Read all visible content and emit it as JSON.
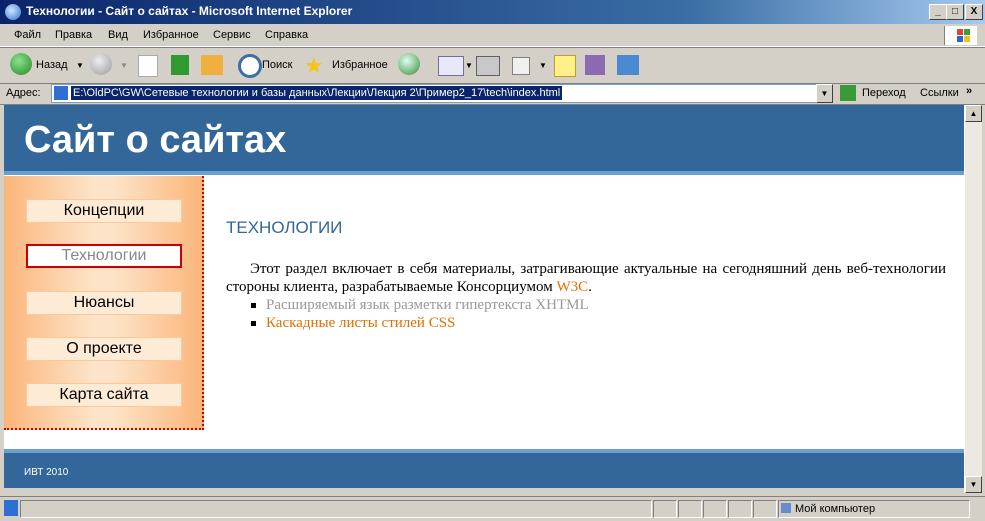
{
  "window": {
    "title": "Технологии - Сайт о сайтах - Microsoft Internet Explorer",
    "minimize": "_",
    "maximize": "□",
    "close": "X"
  },
  "menu": [
    "Файл",
    "Правка",
    "Вид",
    "Избранное",
    "Сервис",
    "Справка"
  ],
  "toolbar": {
    "back_label": "Назад",
    "search_label": "Поиск",
    "favorites_label": "Избранное"
  },
  "address": {
    "label": "Адрес:",
    "url": "E:\\OldPC\\GW\\Сетевые технологии и базы данных\\Лекции\\Лекция 2\\Пример2_17\\tech\\index.html",
    "go_label": "Переход",
    "links_label": "Ссылки",
    "links_chevron": "»"
  },
  "site": {
    "title": "Сайт о сайтах",
    "nav": [
      {
        "label": "Концепции",
        "active": false
      },
      {
        "label": "Технологии",
        "active": true
      },
      {
        "label": "Нюансы",
        "active": false
      },
      {
        "label": "О проекте",
        "active": false
      },
      {
        "label": "Карта сайта",
        "active": false
      }
    ],
    "heading": "ТЕХНОЛОГИИ",
    "paragraph_text": "Этот раздел включает в себя материалы, затрагивающие актуальные на сегодняшний день веб-технологии стороны клиента, разрабатываемые Консорциумом ",
    "paragraph_link": "W3C",
    "paragraph_end": ".",
    "list": [
      {
        "label": "Расширяемый язык разметки гипертекста XHTML",
        "style": "grey"
      },
      {
        "label": "Каскадные листы стилей CSS",
        "style": "orange"
      }
    ],
    "footer": "ИВТ 2010"
  },
  "status": {
    "zone": "Мой компьютер"
  },
  "colors": {
    "header_blue": "#336699",
    "link_orange": "#e07000",
    "active_border": "#cc0000"
  }
}
